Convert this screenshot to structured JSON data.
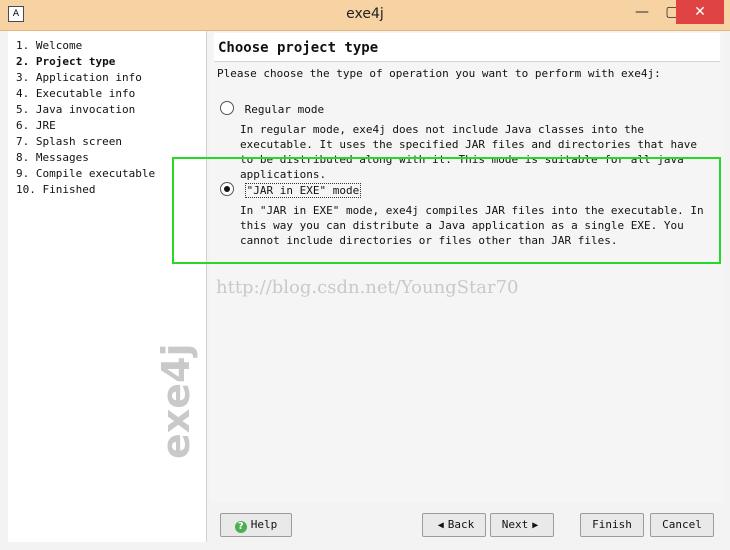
{
  "window": {
    "title": "exe4j"
  },
  "steps": [
    "1. Welcome",
    "2. Project type",
    "3. Application info",
    "4. Executable info",
    "5. Java invocation",
    "6. JRE",
    "7. Splash screen",
    "8. Messages",
    "9. Compile executable",
    "10. Finished"
  ],
  "brand": "exe4j",
  "page": {
    "title": "Choose project type",
    "prompt": "Please choose the type of operation you want to perform with exe4j:",
    "options": [
      {
        "label": "Regular mode",
        "description": "In regular mode, exe4j does not include Java classes into the executable. It uses the specified JAR files and directories that have to be distributed along with it. This mode is suitable for all java applications."
      },
      {
        "label": "\"JAR in EXE\" mode",
        "description": "In \"JAR in EXE\" mode, exe4j compiles JAR files into the executable. In this way you can distribute a Java application as a single EXE. You cannot include directories or files other than JAR files."
      }
    ]
  },
  "watermark": "http://blog.csdn.net/YoungStar70",
  "buttons": {
    "help": "Help",
    "back": "Back",
    "next": "Next",
    "finish": "Finish",
    "cancel": "Cancel"
  }
}
